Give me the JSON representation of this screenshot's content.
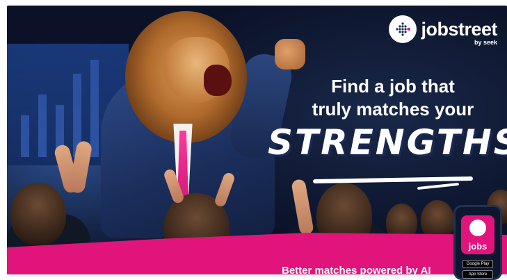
{
  "brand": {
    "name": "jobstreet",
    "sub": "by seek",
    "logo_icon": "jobstreet-dots-icon",
    "accent": "#e0147b"
  },
  "headline": {
    "line1": "Find a job that",
    "line2": "truly matches your",
    "emphasis": "STRENGTHS"
  },
  "tagline": "Better matches powered by AI",
  "app": {
    "label": "jobs",
    "stores": [
      "Google Play",
      "App Store"
    ]
  }
}
